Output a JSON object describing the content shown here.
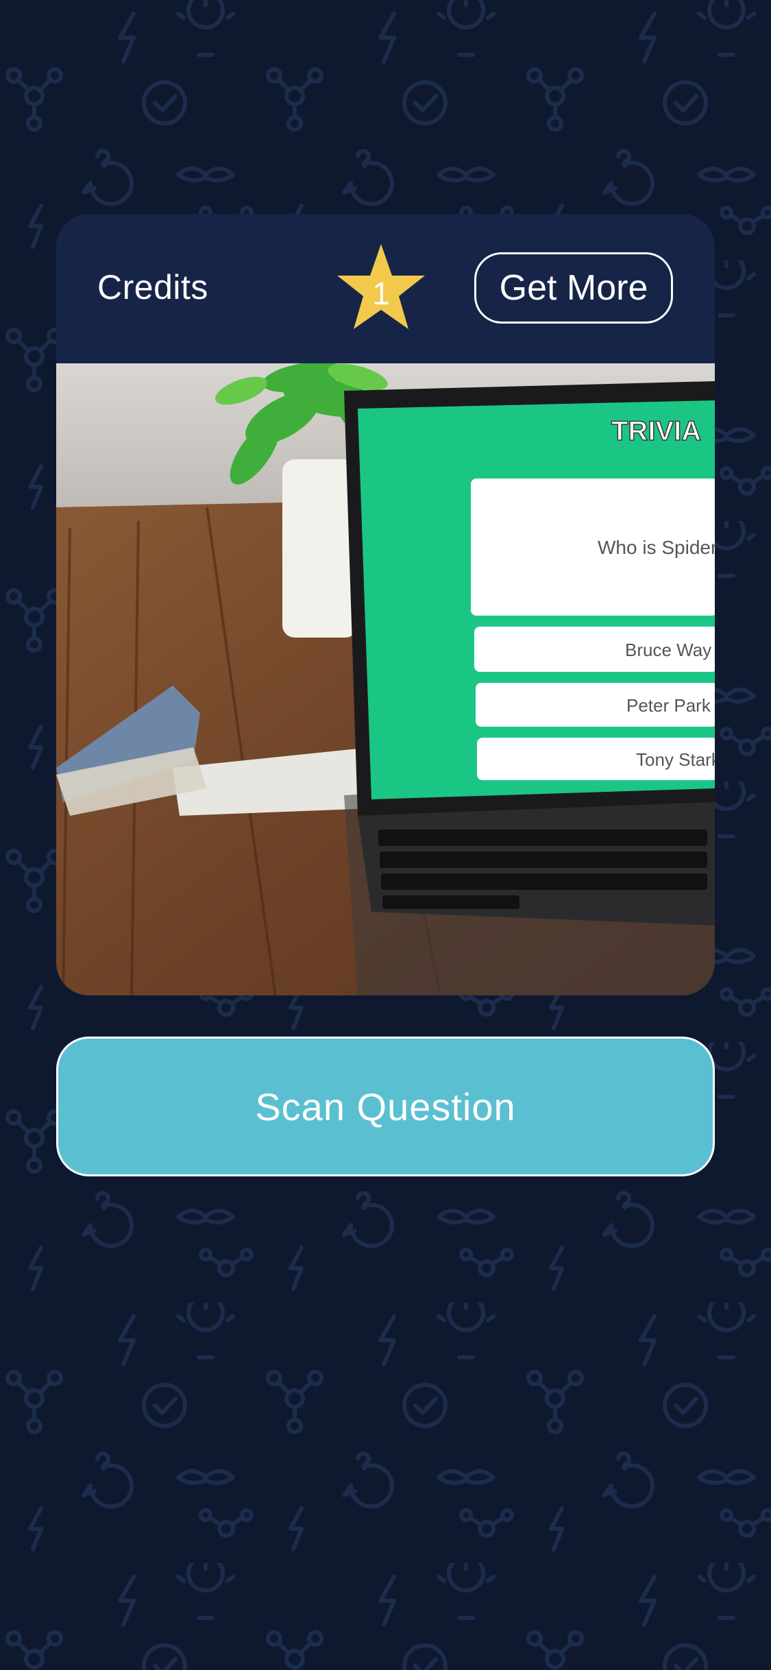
{
  "header": {
    "credits_label": "Credits",
    "credit_count": "1",
    "get_more_label": "Get More"
  },
  "hero": {
    "screen_title": "TRIVIA",
    "question": "Who is Spiderm",
    "answers": [
      "Bruce Way",
      "Peter Park",
      "Tony Stark"
    ]
  },
  "actions": {
    "scan_label": "Scan Question"
  },
  "colors": {
    "background": "#0e1930",
    "card_header": "#162547",
    "star": "#f2c94c",
    "scan_button": "#5bbfd2",
    "trivia_screen": "#1bc685"
  },
  "icons": [
    "atom-icon",
    "lightning-icon",
    "lightbulb-icon",
    "chat-help-icon",
    "check-circle-icon",
    "mustache-icon",
    "star-icon"
  ]
}
